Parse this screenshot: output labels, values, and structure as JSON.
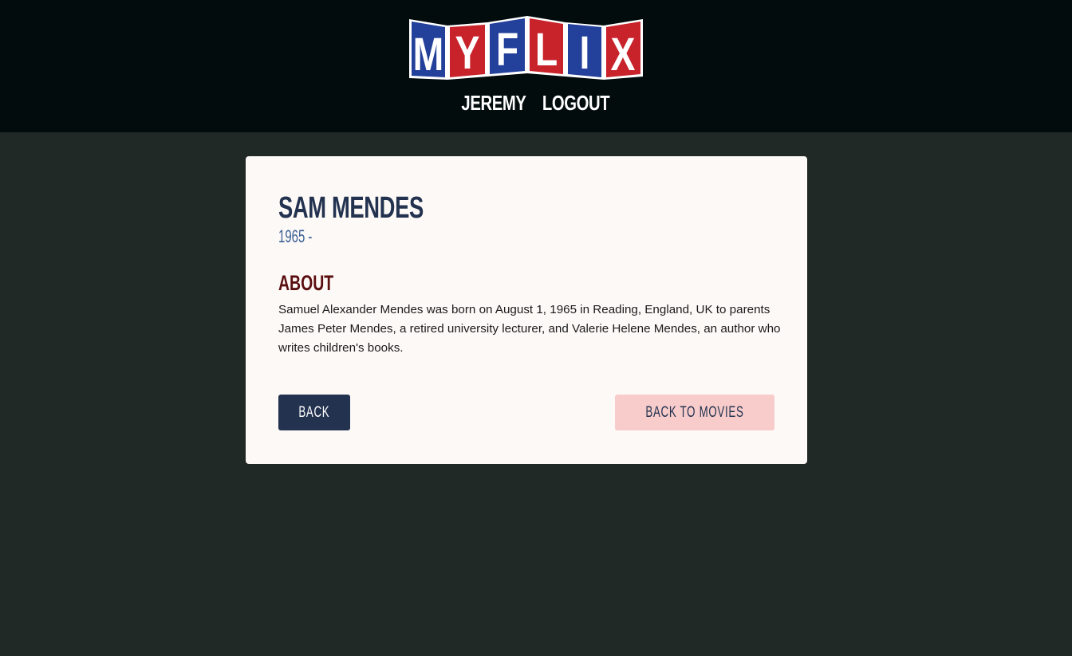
{
  "brand": {
    "logo_letters": [
      "M",
      "Y",
      "F",
      "L",
      "I",
      "X"
    ],
    "colors": {
      "blue": "#23409a",
      "red": "#c8222a",
      "white": "#ffffff"
    }
  },
  "nav": {
    "user_label": "JEREMY",
    "logout_label": "LOGOUT"
  },
  "director": {
    "name": "SAM MENDES",
    "years": "1965 -",
    "about_heading": "ABOUT",
    "bio": "Samuel Alexander Mendes was born on August 1, 1965 in Reading, England, UK to parents James Peter Mendes, a retired university lecturer, and Valerie Helene Mendes, an author who writes children's books."
  },
  "actions": {
    "back_label": "BACK",
    "back_to_movies_label": "BACK TO MOVIES"
  },
  "theme": {
    "page_bg": "#212927",
    "header_bg": "#020c0d",
    "card_bg": "#fdf9f7",
    "primary": "#22324f",
    "accent_pink": "#f8cccb",
    "heading_maroon": "#5a0e10"
  }
}
